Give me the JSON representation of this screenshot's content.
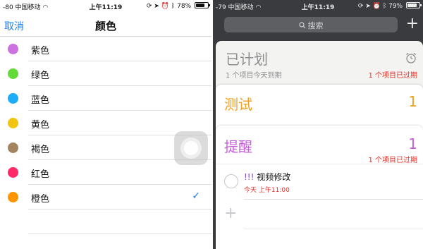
{
  "left_status": {
    "signal": "-80 中国移动",
    "time": "上午11:19",
    "battery": "78%",
    "battery_level": 0.78
  },
  "color_picker": {
    "cancel_label": "取消",
    "title": "颜色",
    "colors": [
      {
        "name": "紫色",
        "hex": "#cc73e1",
        "selected": false
      },
      {
        "name": "绿色",
        "hex": "#63da38",
        "selected": false
      },
      {
        "name": "蓝色",
        "hex": "#1badf8",
        "selected": false
      },
      {
        "name": "黄色",
        "hex": "#f1c40f",
        "selected": false
      },
      {
        "name": "褐色",
        "hex": "#a2845e",
        "selected": false
      },
      {
        "name": "红色",
        "hex": "#ff2968",
        "selected": false
      },
      {
        "name": "橙色",
        "hex": "#ff9500",
        "selected": true
      }
    ],
    "check_glyph": "✓"
  },
  "right_status": {
    "signal": "-79 中国移动",
    "time": "上午11:19",
    "battery": "79%",
    "battery_level": 0.79
  },
  "search": {
    "placeholder": "搜索",
    "add_glyph": "+"
  },
  "planned": {
    "title": "已计划",
    "subtitle": "1 个项目今天到期",
    "overdue": "1 个项目已过期"
  },
  "lists": [
    {
      "title": "测试",
      "count": "1",
      "color": "#f0a020"
    },
    {
      "title": "提醒",
      "count": "1",
      "color": "#c55fdb",
      "overdue": "1 个项目已过期"
    }
  ],
  "reminder": {
    "priority": "!!!",
    "title": "视频修改",
    "due": "今天 上午11:00"
  },
  "new_item_glyph": "+",
  "accent_colors": {
    "ios_blue": "#157efb",
    "overdue_red": "#e5312a"
  }
}
